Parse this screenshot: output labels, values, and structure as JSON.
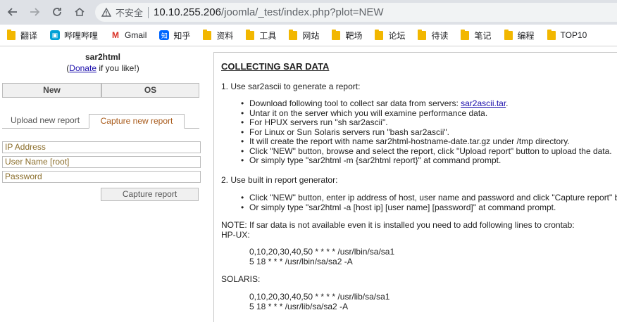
{
  "browser": {
    "url_warning": "不安全",
    "url_host": "10.10.255.206",
    "url_path": "/joomla/_test/index.php?plot=NEW",
    "bookmarks": [
      {
        "label": "翻译",
        "icon": "folder-icon"
      },
      {
        "label": "哔哩哔哩",
        "icon": "bilibili-icon"
      },
      {
        "label": "Gmail",
        "icon": "gmail-icon"
      },
      {
        "label": "知乎",
        "icon": "zhihu-icon"
      },
      {
        "label": "资料",
        "icon": "folder-icon"
      },
      {
        "label": "工具",
        "icon": "folder-icon"
      },
      {
        "label": "网站",
        "icon": "folder-icon"
      },
      {
        "label": "靶场",
        "icon": "folder-icon"
      },
      {
        "label": "论坛",
        "icon": "folder-icon"
      },
      {
        "label": "待读",
        "icon": "folder-icon"
      },
      {
        "label": "笔记",
        "icon": "folder-icon"
      },
      {
        "label": "编程",
        "icon": "folder-icon"
      },
      {
        "label": "TOP10",
        "icon": "folder-icon"
      }
    ]
  },
  "left": {
    "brand": "sar2html",
    "donate_open": "(",
    "donate_link": "Donate",
    "donate_rest": " if you like!)",
    "btn_new": "New",
    "btn_os": "OS",
    "tab_upload": "Upload new report",
    "tab_capture": "Capture new report",
    "field_ip": "IP Address",
    "field_user": "User Name [root]",
    "field_pass": "Password",
    "capture_btn": "Capture report"
  },
  "content": {
    "title": "COLLECTING SAR DATA",
    "step1": "1. Use sar2ascii to generate a report:",
    "s1_b1_pre": "Download following tool to collect sar data from servers: ",
    "s1_b1_link": "sar2ascii.tar",
    "s1_b1_post": ".",
    "s1_b2": "Untar it on the server which you will examine performance data.",
    "s1_b3": "For HPUX servers run \"sh sar2ascii\".",
    "s1_b4": "For Linux or Sun Solaris servers run \"bash sar2ascii\".",
    "s1_b5": "It will create the report with name sar2html-hostname-date.tar.gz under /tmp directory.",
    "s1_b6": "Click \"NEW\" button, browse and select the report, click \"Upload report\" button to upload the data.",
    "s1_b7": "Or simply type \"sar2html -m {sar2html report}\" at command prompt.",
    "step2": "2. Use built in report generator:",
    "s2_b1": "Click \"NEW\" button, enter ip address of host, user name and password and click \"Capture report\" b",
    "s2_b2": "Or simply type \"sar2html -a [host ip] [user name] [password]\" at command prompt.",
    "note": "NOTE: If sar data is not available even it is installed you need to add following lines to crontab:",
    "hpux": "HP-UX:",
    "hp1": "0,10,20,30,40,50 * * * * /usr/lbin/sa/sa1",
    "hp2": "5 18 * * * /usr/lbin/sa/sa2 -A",
    "solaris": "SOLARIS:",
    "so1": "0,10,20,30,40,50 * * * * /usr/lib/sa/sa1",
    "so2": "5 18 * * * /usr/lib/sa/sa2 -A"
  }
}
